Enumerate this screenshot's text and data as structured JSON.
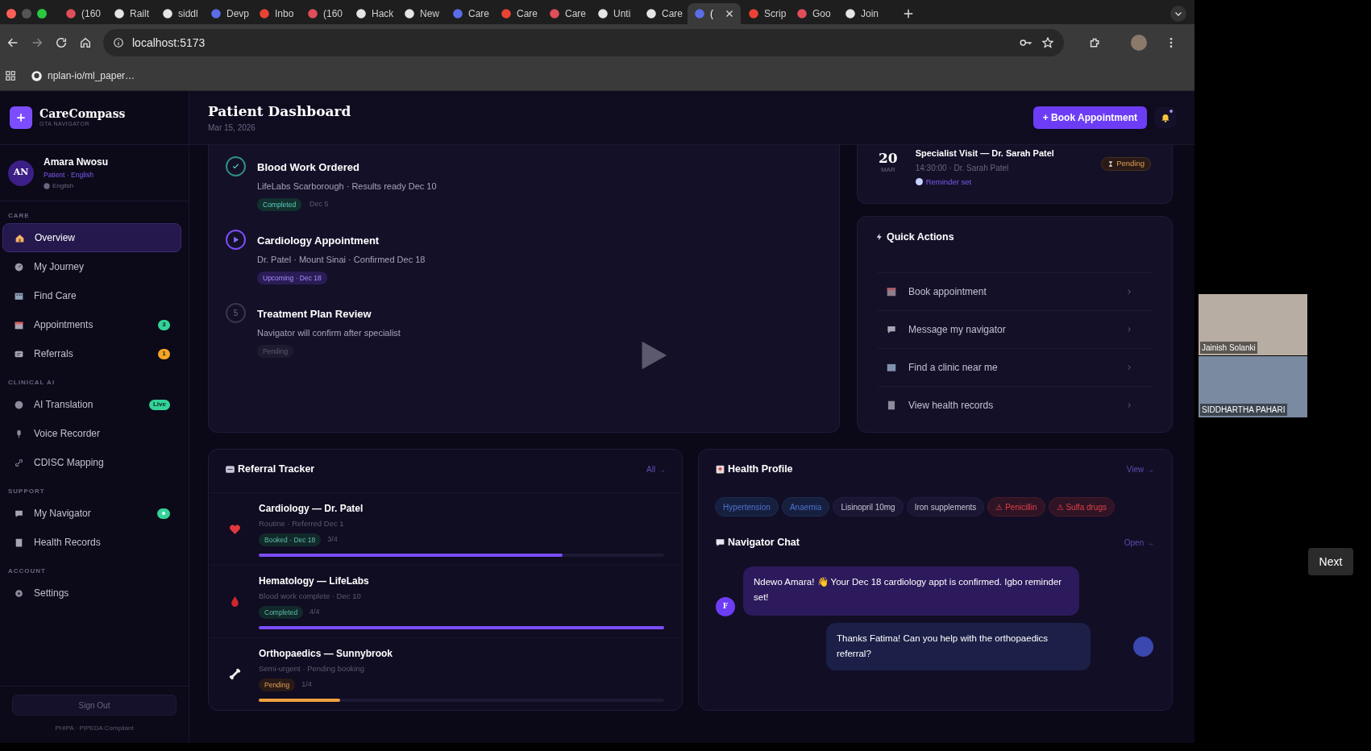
{
  "browser": {
    "tabs": [
      {
        "label": "(160",
        "selected": false
      },
      {
        "label": "Railt",
        "selected": false
      },
      {
        "label": "siddl",
        "selected": false
      },
      {
        "label": "Devp",
        "selected": false
      },
      {
        "label": "Inbo",
        "selected": false
      },
      {
        "label": "(160",
        "selected": false
      },
      {
        "label": "Hack",
        "selected": false
      },
      {
        "label": "New",
        "selected": false
      },
      {
        "label": "Care",
        "selected": false
      },
      {
        "label": "Care",
        "selected": false
      },
      {
        "label": "Care",
        "selected": false
      },
      {
        "label": "Unti",
        "selected": false
      },
      {
        "label": "Care",
        "selected": false
      },
      {
        "label": "(",
        "selected": true
      },
      {
        "label": "Scrip",
        "selected": false
      },
      {
        "label": "Goo",
        "selected": false
      },
      {
        "label": "Join",
        "selected": false
      }
    ],
    "address": "localhost:5173",
    "bookmarks": [
      "nplan-io/ml_paper…"
    ]
  },
  "sidebar": {
    "brand": "CareCompass",
    "tagline": "GTA NAVIGATOR",
    "user": {
      "initials": "AN",
      "name": "Amara Nwosu",
      "role": "Patient · English",
      "language": "English"
    },
    "sections": [
      {
        "label": "CARE",
        "items": [
          {
            "label": "Overview",
            "selected": true
          },
          {
            "label": "My Journey",
            "selected": false
          },
          {
            "label": "Find Care",
            "selected": false
          },
          {
            "label": "Appointments",
            "selected": false,
            "badge": {
              "text": "3",
              "color": "#34d399"
            }
          },
          {
            "label": "Referrals",
            "selected": false,
            "badge": {
              "text": "1",
              "color": "#f5a524"
            }
          }
        ]
      },
      {
        "label": "CLINICAL AI",
        "items": [
          {
            "label": "AI Translation",
            "selected": false,
            "badge": {
              "text": "Live",
              "color": "#34d399"
            }
          },
          {
            "label": "Voice Recorder",
            "selected": false
          },
          {
            "label": "CDISC Mapping",
            "selected": false
          }
        ]
      },
      {
        "label": "SUPPORT",
        "items": [
          {
            "label": "My Navigator",
            "selected": false,
            "badge": {
              "color": "#34d399"
            }
          },
          {
            "label": "Health Records",
            "selected": false
          }
        ]
      },
      {
        "label": "ACCOUNT",
        "items": [
          {
            "label": "Settings",
            "selected": false
          }
        ]
      }
    ],
    "sign_out": "Sign Out",
    "compliance": "PHIPA · PIPEDA Compliant"
  },
  "header": {
    "title": "Patient Dashboard",
    "date": "Mar 15, 2026",
    "action": "+ Book Appointment",
    "has_unread": true
  },
  "journey": {
    "steps": [
      {
        "kind": "done",
        "title": "Blood Work Ordered",
        "detail": "LifeLabs Scarborough · Results ready Dec 10",
        "tag": "Completed",
        "date": "Dec 5"
      },
      {
        "kind": "current",
        "title": "Cardiology Appointment",
        "detail": "Dr. Patel · Mount Sinai · Confirmed Dec 18",
        "tag": "Upcoming · Dec 18"
      },
      {
        "kind": "pending",
        "number": "5",
        "title": "Treatment Plan Review",
        "detail": "Navigator will confirm after specialist",
        "tag": "Pending"
      }
    ]
  },
  "appointment": {
    "day": "20",
    "month": "MAR",
    "title": "Specialist Visit — Dr. Sarah Patel",
    "detail": "14:30:00 · Dr. Sarah Patel",
    "reminder": "Reminder set",
    "status": "Pending"
  },
  "quick_actions": {
    "title": "Quick Actions",
    "items": [
      "Book appointment",
      "Message my navigator",
      "Find a clinic near me",
      "View health records"
    ]
  },
  "referrals": {
    "title": "Referral Tracker",
    "link": "All →",
    "items": [
      {
        "kind": "booked",
        "title": "Cardiology — Dr. Patel",
        "detail": "Routine · Referred Dec 1",
        "tag": "Booked · Dec 18",
        "progress": "3/4",
        "level": 0.75
      },
      {
        "kind": "completed",
        "title": "Hematology — LifeLabs",
        "detail": "Blood work complete · Dec 10",
        "tag": "Completed",
        "progress": "4/4",
        "level": 1
      },
      {
        "kind": "pending",
        "title": "Orthopaedics — Sunnybrook",
        "detail": "Semi-urgent · Pending booking",
        "tag": "Pending",
        "progress": "1/4",
        "level": 0.2
      }
    ]
  },
  "health_profile": {
    "title": "Health Profile",
    "link": "View →",
    "tags": [
      {
        "label": "Hypertension",
        "kind": "condition"
      },
      {
        "label": "Anaemia",
        "kind": "condition"
      },
      {
        "label": "Lisinopril 10mg",
        "kind": "medication"
      },
      {
        "label": "Iron supplements",
        "kind": "medication"
      },
      {
        "label": "⚠ Penicillin",
        "kind": "allergy"
      },
      {
        "label": "⚠ Sulfa drugs",
        "kind": "allergy"
      }
    ]
  },
  "chat": {
    "title": "Navigator Chat",
    "link": "Open →",
    "messages": [
      {
        "kind": "navigator",
        "avatar": "F",
        "text": "Ndewo Amara! 👋 Your Dec 18 cardiology appt is confirmed. Igbo reminder set!"
      },
      {
        "kind": "patient",
        "text": "Thanks Fatima! Can you help with the orthopaedics referral?"
      }
    ]
  },
  "call": {
    "participants": [
      {
        "name": "Jainish Solanki"
      },
      {
        "name": "SIDDHARTHA PAHARI"
      }
    ],
    "next": "Next"
  }
}
